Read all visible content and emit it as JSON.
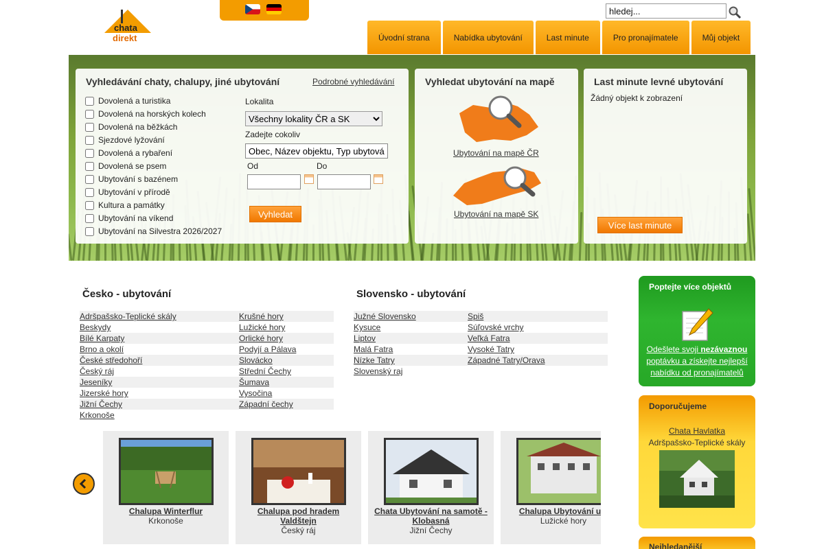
{
  "header": {
    "logo_text_top": "chata",
    "logo_text_bottom": "direkt",
    "search": {
      "value": "hledej..."
    },
    "nav": [
      {
        "label": "Úvodní strana"
      },
      {
        "label": "Nabídka ubytování"
      },
      {
        "label": "Last minute"
      },
      {
        "label": "Pro pronajímatele"
      },
      {
        "label": "Můj objekt"
      }
    ]
  },
  "search_panel": {
    "title": "Vyhledávání chaty, chalupy, jiné ubytování",
    "advanced_link": "Podrobné vyhledávání",
    "checkboxes": [
      "Dovolená a turistika",
      "Dovolená na horských kolech",
      "Dovolená na běžkách",
      "Sjezdové lyžování",
      "Dovolená a rybaření",
      "Dovolená se psem",
      "Ubytování s bazénem",
      "Ubytování v přírodě",
      "Kultura a památky",
      "Ubytování na víkend",
      "Ubytování na Silvestra 2026/2027"
    ],
    "locality_label": "Lokalita",
    "locality_selected": "Všechny lokality ČR a SK",
    "anything_label": "Zadejte cokoliv",
    "anything_value": "Obec, Název objektu, Typ ubytování",
    "from_label": "Od",
    "to_label": "Do",
    "submit": "Vyhledat"
  },
  "map_panel": {
    "title": "Vyhledat ubytování na mapě",
    "cz_link": "Ubytování na mapě ČR",
    "sk_link": "Ubytování na mapě SK"
  },
  "lastminute_panel": {
    "title": "Last minute levné ubytování",
    "empty": "Žádný objekt k zobrazení",
    "more": "Více last minute"
  },
  "czech": {
    "title": "Česko - ubytování",
    "col1": [
      "Adršpašsko-Teplické skály",
      "Beskydy",
      "Bílé Karpaty",
      "Brno a okolí",
      "České středohoří",
      "Český ráj",
      "Jeseníky",
      "Jizerské hory",
      "Jižní Čechy",
      "Krkonoše"
    ],
    "col2": [
      "Krušné hory",
      "Lužické hory",
      "Orlické hory",
      "Podyjí a Pálava",
      "Slovácko",
      "Střední Čechy",
      "Šumava",
      "Vysočina",
      "Západní čechy"
    ]
  },
  "slovakia": {
    "title": "Slovensko - ubytování",
    "col1": [
      "Južné Slovensko",
      "Kysuce",
      "Liptov",
      "Malá Fatra",
      "Nízke Tatry",
      "Slovenský raj"
    ],
    "col2": [
      "Spiš",
      "Súľovské vrchy",
      "Veľká Fatra",
      "Vysoké Tatry",
      "Západné Tatry/Orava"
    ]
  },
  "carousel": [
    {
      "name": "Chalupa Winterflur",
      "region": "Krkonoše"
    },
    {
      "name": "Chalupa pod hradem Valdštejn",
      "region": "Český ráj"
    },
    {
      "name": "Chata Ubytování na samotě - Klobasná",
      "region": "Jižní Čechy"
    },
    {
      "name": "Chalupa Ubytování u J",
      "region": "Lužické hory"
    }
  ],
  "inquiry_box": {
    "title": "Poptejte více objektů",
    "text_pre": "Odešlete svoji ",
    "text_bold": "nezávaznou",
    "text_post": " poptávku a získejte nejlepší nabídku od pronajímatelů"
  },
  "recommend_box": {
    "title": "Doporučujeme",
    "name": "Chata Havlatka",
    "region": "Adršpašsko-Teplické skály"
  },
  "popular_box": {
    "title": "Nejhledanější"
  }
}
